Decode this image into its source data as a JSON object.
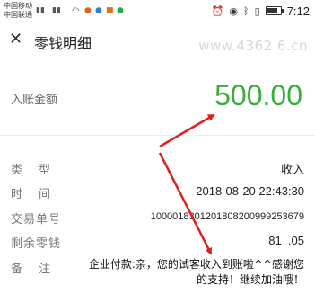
{
  "status_bar": {
    "carrier_1": "中国移动",
    "carrier_1_badge": "HD",
    "carrier_2": "中国联通",
    "network": "4G",
    "time": "7:12",
    "battery_level": 0.8
  },
  "nav": {
    "title": "零钱明细",
    "watermark": "www.4362 6.cn"
  },
  "amount": {
    "label": "入账金额",
    "value": "500.00",
    "color": "#3aad3a"
  },
  "details": {
    "type_label": "类型",
    "type_value": "收入",
    "time_label": "时间",
    "time_value": "2018-08-20 22:43:30",
    "txn_label": "交易单号",
    "txn_value": "1000018301201808200999253679",
    "balance_label": "剩余零钱",
    "balance_value": "81  .05",
    "remark_label": "备注",
    "remark_value": "企业付款:亲，您的试客收入到账啦^^感谢您的支持！继续加油哦！"
  },
  "annotation_color": "#e02020"
}
